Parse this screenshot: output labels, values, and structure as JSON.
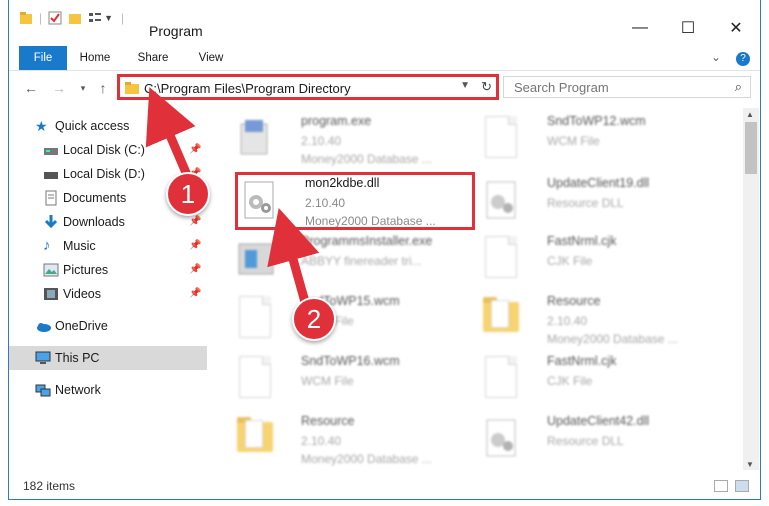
{
  "window": {
    "title": "Program",
    "minimize_glyph": "—",
    "maximize_glyph": "☐",
    "close_glyph": "✕"
  },
  "ribbon": {
    "tabs": [
      "File",
      "Home",
      "Share",
      "View"
    ],
    "help_glyph": "?",
    "expand_glyph": "⌄"
  },
  "address": {
    "path": "C:\\Program Files\\Program Directory",
    "search_placeholder": "Search Program"
  },
  "nav": {
    "items": [
      {
        "label": "Quick access",
        "icon": "star-icon",
        "pinned": false
      },
      {
        "label": "Local Disk (C:)",
        "icon": "drive-icon",
        "pinned": true
      },
      {
        "label": "Local Disk (D:)",
        "icon": "drive-icon",
        "pinned": true
      },
      {
        "label": "Documents",
        "icon": "documents-icon",
        "pinned": true
      },
      {
        "label": "Downloads",
        "icon": "download-icon",
        "pinned": true
      },
      {
        "label": "Music",
        "icon": "music-icon",
        "pinned": true
      },
      {
        "label": "Pictures",
        "icon": "pictures-icon",
        "pinned": true
      },
      {
        "label": "Videos",
        "icon": "videos-icon",
        "pinned": true
      },
      {
        "label": "OneDrive",
        "icon": "cloud-icon",
        "pinned": false
      },
      {
        "label": "This PC",
        "icon": "computer-icon",
        "pinned": false,
        "selected": true
      },
      {
        "label": "Network",
        "icon": "network-icon",
        "pinned": false
      }
    ]
  },
  "files": [
    {
      "name": "program.exe",
      "line2": "2.10.40",
      "line3": "Money2000 Database ...",
      "icon": "exe-icon"
    },
    {
      "name": "SndToWP12.wcm",
      "line2": "WCM File",
      "line3": "",
      "icon": "file-icon"
    },
    {
      "name": "mon2kdbe.dll",
      "line2": "2.10.40",
      "line3": "Money2000 Database ...",
      "icon": "dll-icon",
      "highlighted": true
    },
    {
      "name": "UpdateClient19.dll",
      "line2": "Resource DLL",
      "line3": "",
      "icon": "dll-icon"
    },
    {
      "name": "ProgrammsInstaller.exe",
      "line2": "ABBYY finereader tri...",
      "line3": "",
      "icon": "installer-icon"
    },
    {
      "name": "FastNrml.cjk",
      "line2": "CJK File",
      "line3": "",
      "icon": "file-icon"
    },
    {
      "name": "SndToWP15.wcm",
      "line2": "WCM File",
      "line3": "",
      "icon": "file-icon"
    },
    {
      "name": "Resource",
      "line2": "2.10.40",
      "line3": "Money2000 Database ...",
      "icon": "folder-icon"
    },
    {
      "name": "SndToWP16.wcm",
      "line2": "WCM File",
      "line3": "",
      "icon": "file-icon"
    },
    {
      "name": "FastNrml.cjk",
      "line2": "CJK File",
      "line3": "",
      "icon": "file-icon"
    },
    {
      "name": "Resource",
      "line2": "2.10.40",
      "line3": "Money2000 Database ...",
      "icon": "folder-icon"
    },
    {
      "name": "UpdateClient42.dll",
      "line2": "Resource DLL",
      "line3": "",
      "icon": "dll-icon"
    }
  ],
  "status": {
    "item_count": "182 items"
  },
  "annotations": {
    "step1": "1",
    "step2": "2",
    "highlight_color": "#e0303a"
  },
  "colors": {
    "accent": "#1979ca",
    "annotation": "#e0303a"
  }
}
